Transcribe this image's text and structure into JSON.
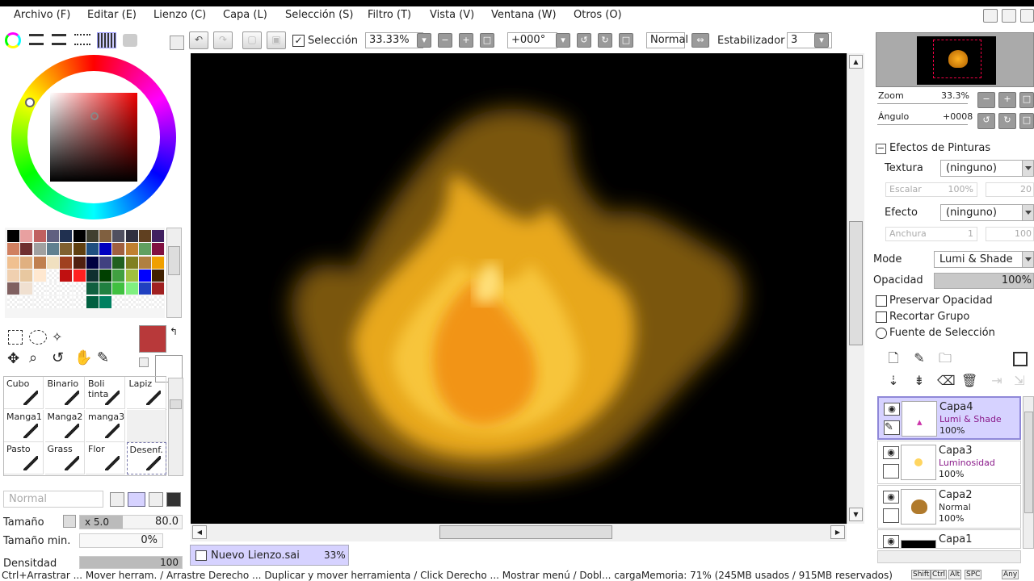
{
  "menu": {
    "items": [
      "Archivo (F)",
      "Editar (E)",
      "Lienzo (C)",
      "Capa (L)",
      "Selección (S)",
      "Filtro (T)",
      "Vista (V)",
      "Ventana (W)",
      "Otros (O)"
    ]
  },
  "toolbar": {
    "selection_label": "Selección",
    "zoom_value": "33.33%",
    "angle_value": "+000°",
    "blend_mode": "Normal",
    "stabilizer_label": "Estabilizador",
    "stabilizer_value": "3"
  },
  "navigator": {
    "zoom_label": "Zoom",
    "zoom_value": "33.3%",
    "angle_label": "Ángulo",
    "angle_value": "+0008"
  },
  "effects": {
    "header": "Efectos de Pinturas",
    "texture_label": "Textura",
    "texture_value": "(ninguno)",
    "scale_label": "Escalar",
    "scale_value": "100%",
    "scale_value2": "20",
    "effect_label": "Efecto",
    "effect_value": "(ninguno)",
    "width_label": "Anchura",
    "width_value": "1",
    "width_value2": "100"
  },
  "layer_props": {
    "mode_label": "Mode",
    "mode_value": "Lumi & Shade",
    "opacity_label": "Opacidad",
    "opacity_value": "100%",
    "preserve_opacity": "Preservar Opacidad",
    "clip_group": "Recortar Grupo",
    "selection_source": "Fuente de Selección"
  },
  "layers": [
    {
      "name": "Capa4",
      "mode": "Lumi & Shade",
      "opacity": "100%",
      "selected": true
    },
    {
      "name": "Capa3",
      "mode": "Luminosidad",
      "opacity": "100%",
      "selected": false
    },
    {
      "name": "Capa2",
      "mode": "Normal",
      "opacity": "100%",
      "selected": false
    },
    {
      "name": "Capa1",
      "mode": "",
      "opacity": "",
      "selected": false
    }
  ],
  "brushes": [
    [
      "Cubo",
      "Binario",
      "Boli tinta",
      "Lapiz"
    ],
    [
      "Manga1",
      "Manga2",
      "manga3",
      ""
    ],
    [
      "Pasto",
      "Grass",
      "Flor",
      "Desenf."
    ]
  ],
  "brush_settings": {
    "blend_mode": "Normal",
    "size_label": "Tamaño",
    "size_multiplier": "x 5.0",
    "size_value": "80.0",
    "min_size_label": "Tamaño min.",
    "min_size_value": "0%",
    "density_label": "Densitdad",
    "density_value": "100"
  },
  "document": {
    "tab_name": "Nuevo Lienzo.sai",
    "zoom": "33%"
  },
  "colors": {
    "primary": "#b8393a",
    "secondary": "#ffffff",
    "selected_layer_bg": "#d6d2ff"
  },
  "status": {
    "text": "Ctrl+Arrastrar ... Mover herram. / Arrastre Derecho ... Duplicar y mover herramienta / Click Derecho ... Mostrar menú / Dobl... cargaMemoria: 71% (245MB usados / 915MB reservados)",
    "keys": [
      "Shift",
      "Ctrl",
      "Alt",
      "SPC",
      "Any"
    ]
  }
}
